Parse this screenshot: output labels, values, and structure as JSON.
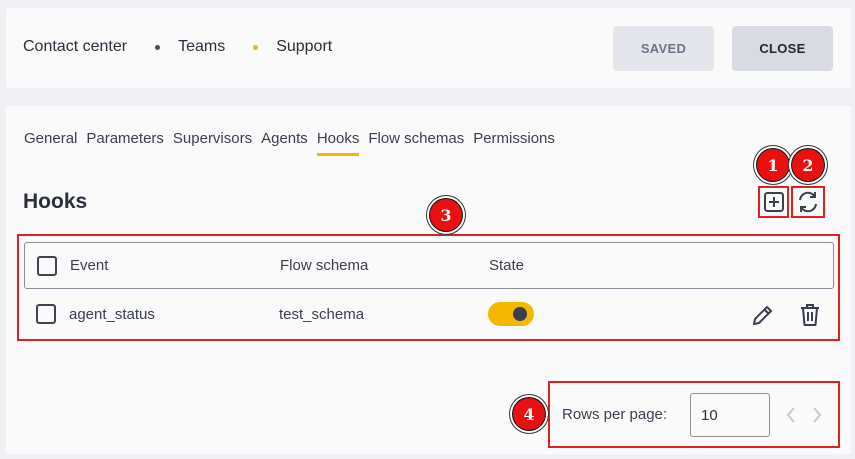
{
  "breadcrumb": {
    "items": [
      "Contact center",
      "Teams",
      "Support"
    ],
    "dot_colors": [
      "#4a4f62",
      "#f5b800"
    ]
  },
  "header": {
    "saved_label": "SAVED",
    "close_label": "CLOSE"
  },
  "tabs": [
    {
      "label": "General",
      "active": false
    },
    {
      "label": "Parameters",
      "active": false
    },
    {
      "label": "Supervisors",
      "active": false
    },
    {
      "label": "Agents",
      "active": false
    },
    {
      "label": "Hooks",
      "active": true
    },
    {
      "label": "Flow schemas",
      "active": false
    },
    {
      "label": "Permissions",
      "active": false
    }
  ],
  "section": {
    "title": "Hooks",
    "add_icon": "add-box-icon",
    "refresh_icon": "refresh-icon"
  },
  "table": {
    "columns": [
      "Event",
      "Flow schema",
      "State"
    ],
    "rows": [
      {
        "event": "agent_status",
        "flow_schema": "test_schema",
        "state": true
      }
    ]
  },
  "pagination": {
    "rows_per_page_label": "Rows per page:",
    "rows_per_page_value": "10"
  },
  "annotations": [
    "1",
    "2",
    "3",
    "4"
  ],
  "colors": {
    "accent": "#f5b800",
    "annotation_red": "#e81010"
  }
}
